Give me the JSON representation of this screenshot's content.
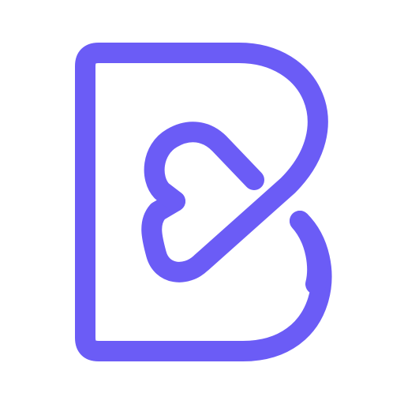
{
  "logo": {
    "icon": "b-heart-logo-icon",
    "color": "#6b5cf6",
    "background": "#ffffff"
  }
}
